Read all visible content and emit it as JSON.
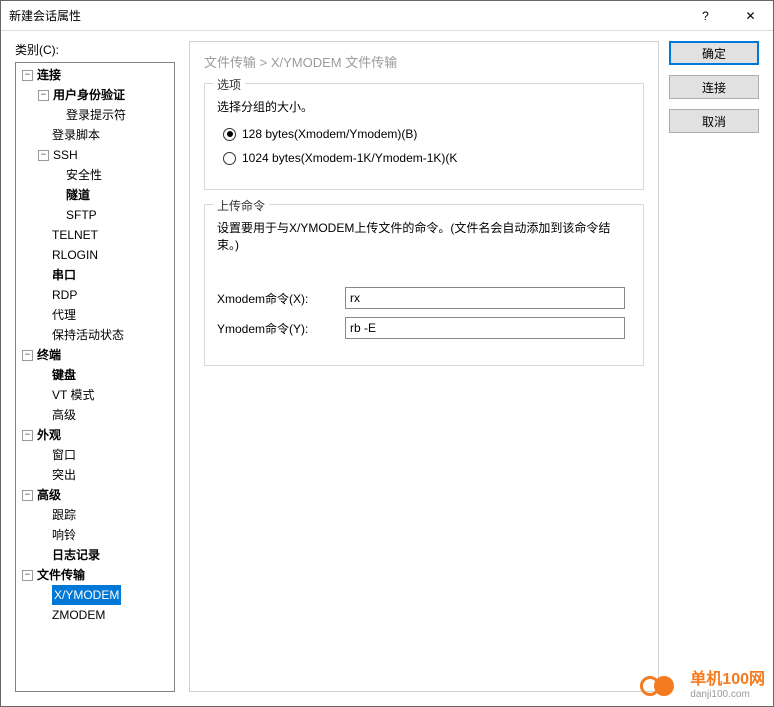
{
  "title": "新建会话属性",
  "category_label": "类别(C):",
  "breadcrumb": "文件传输  >  X/YMODEM 文件传输",
  "buttons": {
    "ok": "确定",
    "connect": "连接",
    "cancel": "取消"
  },
  "options": {
    "legend": "选项",
    "desc": "选择分组的大小。",
    "r128": "128 bytes(Xmodem/Ymodem)(B)",
    "r1024": "1024 bytes(Xmodem-1K/Ymodem-1K)(K"
  },
  "upload": {
    "legend": "上传命令",
    "desc": "设置要用于与X/YMODEM上传文件的命令。(文件名会自动添加到该命令结束。)",
    "xlabel": "Xmodem命令(X):",
    "xval": "rx",
    "ylabel": "Ymodem命令(Y):",
    "yval": "rb -E"
  },
  "tree": {
    "n0": "连接",
    "n0_0": "用户身份验证",
    "n0_0_0": "登录提示符",
    "n0_1": "登录脚本",
    "n0_2": "SSH",
    "n0_2_0": "安全性",
    "n0_2_1": "隧道",
    "n0_2_2": "SFTP",
    "n0_3": "TELNET",
    "n0_4": "RLOGIN",
    "n0_5": "串口",
    "n0_6": "RDP",
    "n0_7": "代理",
    "n0_8": "保持活动状态",
    "n1": "终端",
    "n1_0": "键盘",
    "n1_1": "VT 模式",
    "n1_2": "高级",
    "n2": "外观",
    "n2_0": "窗口",
    "n2_1": "突出",
    "n3": "高级",
    "n3_0": "跟踪",
    "n3_1": "响铃",
    "n3_2": "日志记录",
    "n4": "文件传输",
    "n4_0": "X/YMODEM",
    "n4_1": "ZMODEM"
  },
  "watermark": {
    "t1": "单机100网",
    "t2": "danji100.com"
  }
}
